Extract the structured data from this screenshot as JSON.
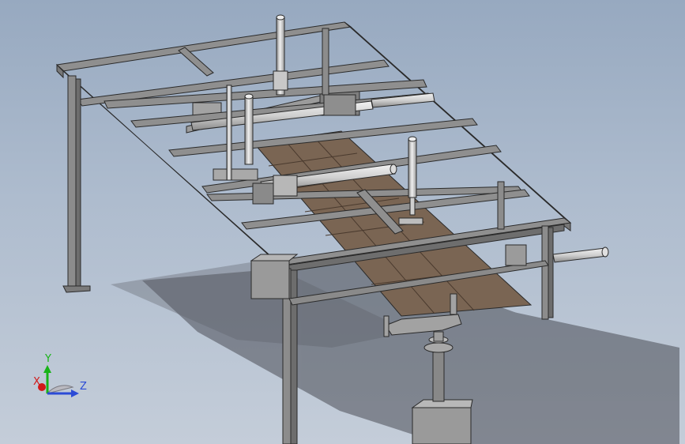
{
  "viewport": {
    "background_top": "#97a9c0",
    "background_bottom": "#c4cdd9"
  },
  "triad": {
    "x_label": "X",
    "y_label": "Y",
    "z_label": "Z",
    "x_color": "#d11a1a",
    "y_color": "#18b318",
    "z_color": "#2b4bd6"
  },
  "model": {
    "frame_color": "#8f8f8f",
    "frame_edge": "#2a2a2a",
    "panel_color": "#7a6553",
    "cylinder_color": "#d9d9d9",
    "shadow_color": "#4a4d55"
  }
}
